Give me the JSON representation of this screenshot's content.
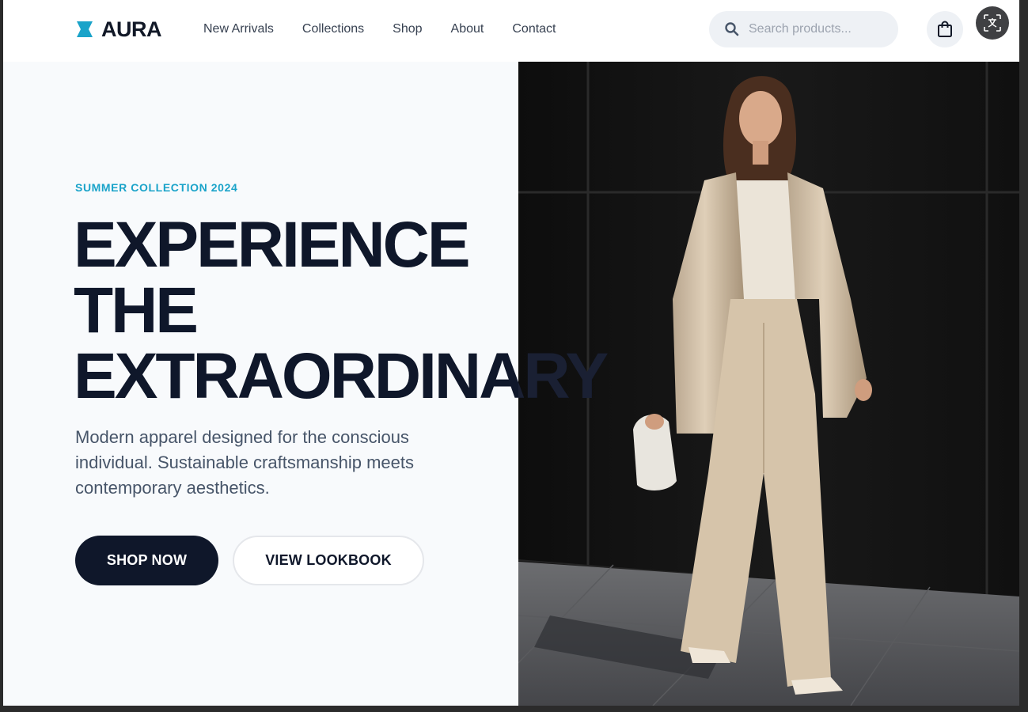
{
  "brand": {
    "name": "AURA",
    "accent": "#1aa3c9",
    "dark": "#0f172a"
  },
  "nav": {
    "items": [
      {
        "label": "New Arrivals"
      },
      {
        "label": "Collections"
      },
      {
        "label": "Shop"
      },
      {
        "label": "About"
      },
      {
        "label": "Contact"
      }
    ]
  },
  "search": {
    "placeholder": "Search products...",
    "icon": "search-icon"
  },
  "header_actions": {
    "cart_icon": "shopping-bag-icon",
    "translate_icon": "translate-icon"
  },
  "hero": {
    "eyebrow": "SUMMER COLLECTION 2024",
    "headline": [
      "EXPERIENCE",
      "THE",
      "EXTRAORDINARY"
    ],
    "description": "Modern apparel designed for the conscious individual. Sustainable craftsmanship meets contemporary aesthetics.",
    "primary_cta": "SHOP NOW",
    "secondary_cta": "VIEW LOOKBOOK"
  }
}
